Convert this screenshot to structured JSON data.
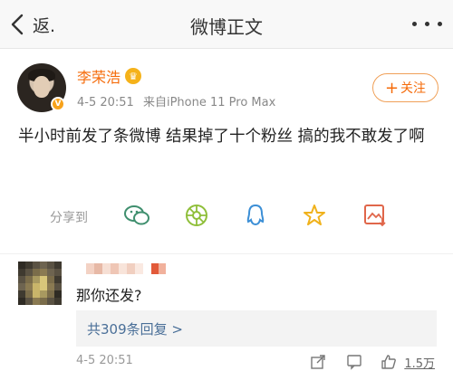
{
  "nav": {
    "back_label": "返.",
    "title": "微博正文",
    "icons": {
      "back": "chevron-left-icon",
      "more": "more-dots-icon"
    }
  },
  "post": {
    "username": "李荣浩",
    "time": "4-5 20:51",
    "source": "来自iPhone 11 Pro Max",
    "follow_label": "关注",
    "content": "半小时前发了条微博 结果掉了十个粉丝 搞的我不敢发了啊",
    "share": {
      "label": "分享到",
      "icons": [
        "wechat-icon",
        "moments-icon",
        "qq-icon",
        "qzone-star-icon",
        "image-save-icon"
      ]
    },
    "icons": {
      "verified": "verified-v-icon",
      "crown": "crown-icon"
    },
    "colors": {
      "username": "#f56b0a",
      "accent": "#f56b0a"
    }
  },
  "comment": {
    "text": "那你还发?",
    "replies_label": "共309条回复 >",
    "time": "4-5 20:51",
    "likes": "1.5万",
    "icons": [
      "share-icon",
      "comment-icon",
      "like-icon"
    ],
    "colors": {
      "replies": "#4a6f98"
    }
  }
}
